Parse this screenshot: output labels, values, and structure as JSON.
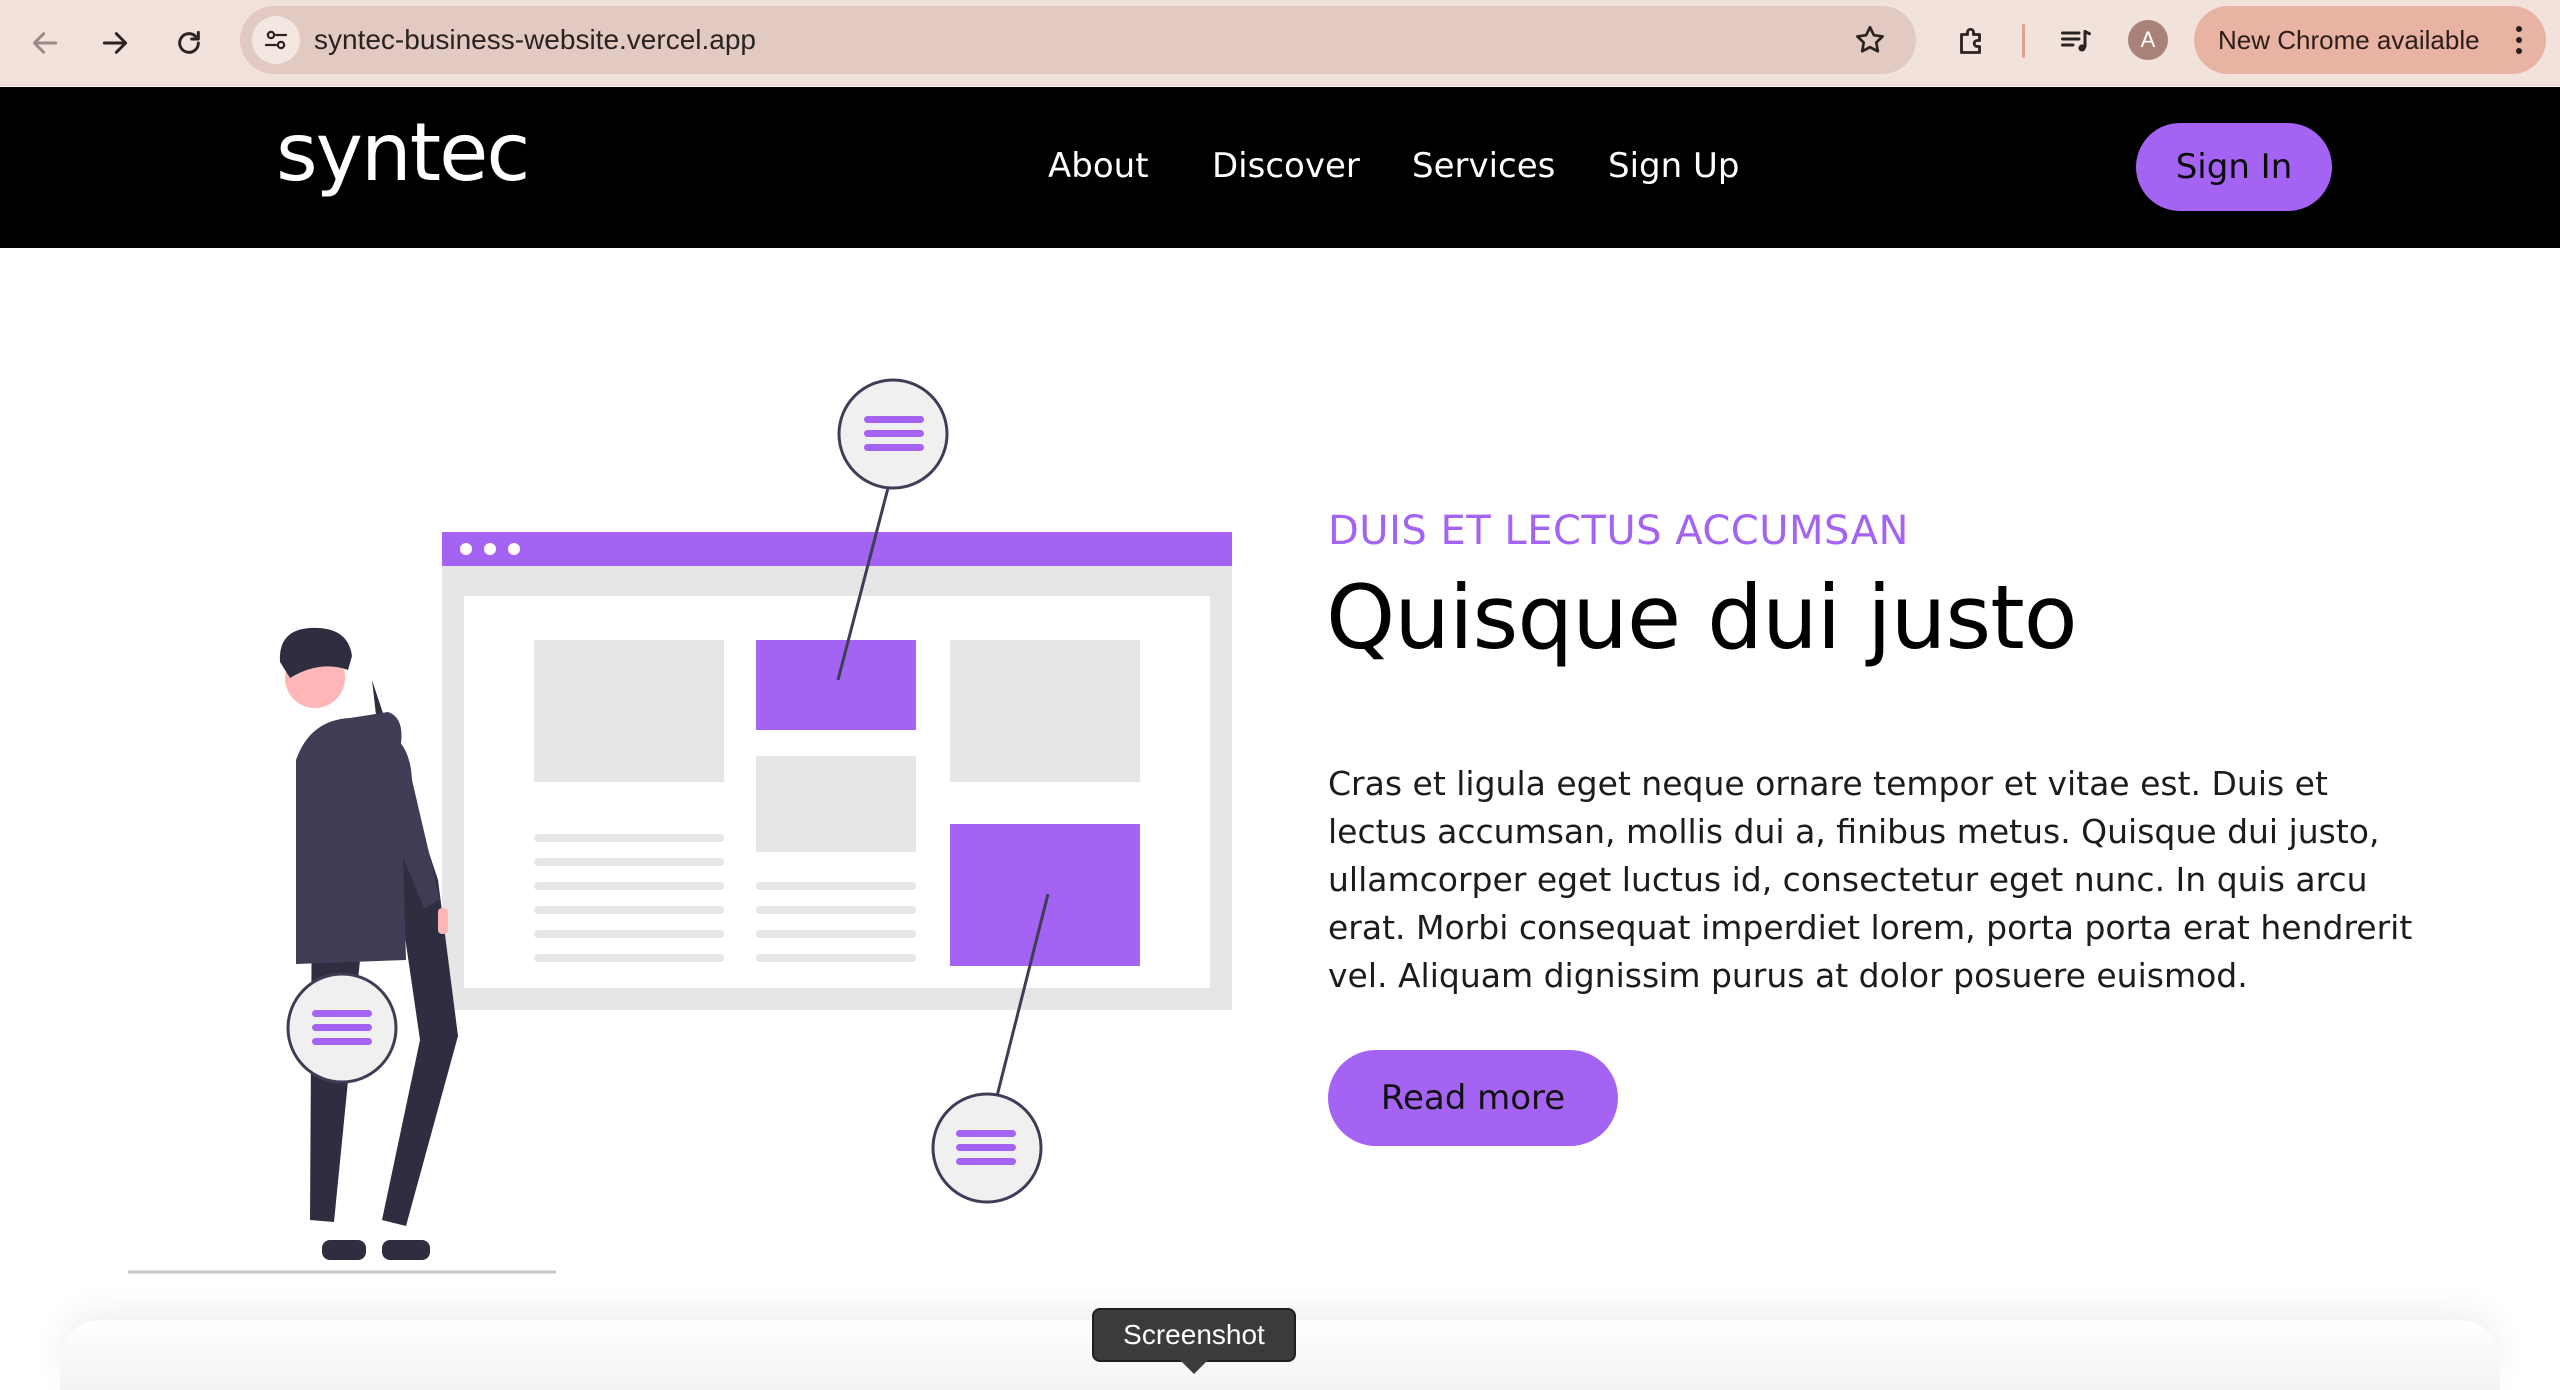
{
  "browser": {
    "url": "syntec-business-website.vercel.app",
    "profile_initial": "A",
    "update_label": "New Chrome available",
    "icons": [
      "back-arrow-icon",
      "forward-arrow-icon",
      "reload-icon",
      "site-info-icon",
      "star-icon",
      "extensions-icon",
      "media-controls-icon",
      "kebab-menu-icon"
    ]
  },
  "header": {
    "logo": "syntec",
    "nav": [
      "About",
      "Discover",
      "Services",
      "Sign Up"
    ],
    "signin_label": "Sign In"
  },
  "hero": {
    "eyebrow": "DUIS ET LECTUS ACCUMSAN",
    "title": "Quisque dui justo",
    "body": "Cras et ligula eget neque ornare tempor et vitae est. Duis et lectus accumsan, mollis dui a, finibus metus. Quisque dui justo, ullamcorper eget luctus id, consectetur eget nunc. In quis arcu erat. Morbi consequat imperdiet lorem, porta porta erat hendrerit vel. Aliquam dignissim purus at dolor posuere euismod.",
    "cta_label": "Read more"
  },
  "tooltip": {
    "label": "Screenshot"
  },
  "colors": {
    "accent": "#a463f2",
    "header_bg": "#000000",
    "chrome_bg": "#f2e2dc"
  }
}
